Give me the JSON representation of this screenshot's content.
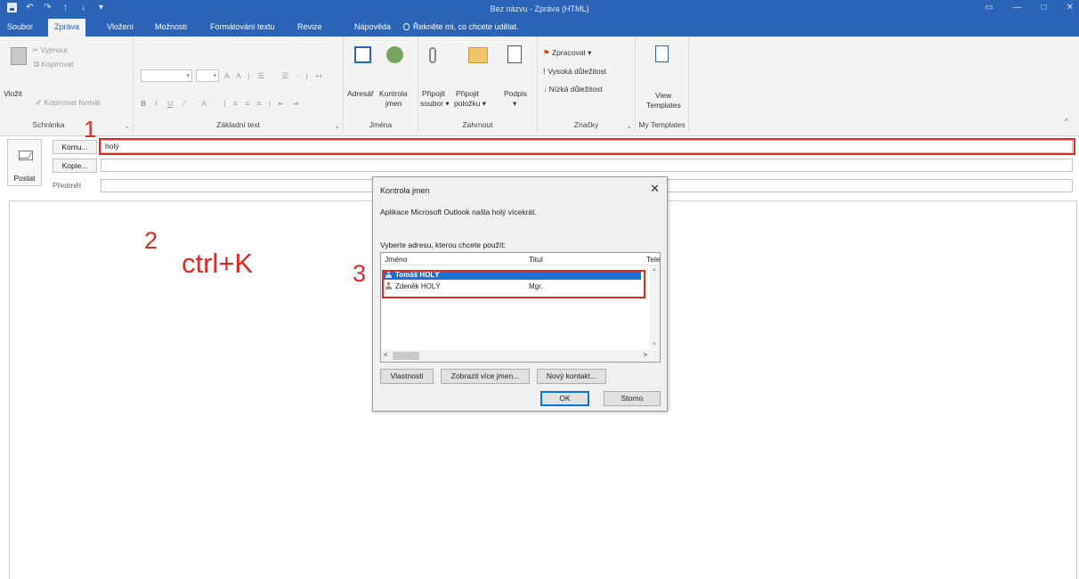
{
  "window": {
    "title": "Bez názvu - Zpráva (HTML)"
  },
  "tabs": [
    "Soubor",
    "Zpráva",
    "Vložení",
    "Možnosti",
    "Formátování textu",
    "Revize",
    "Nápověda"
  ],
  "tell_me": "Řekněte mi, co chcete udělat.",
  "ribbon": {
    "clipboard": {
      "paste": "Vložit",
      "cut": "Vyjmout",
      "copy": "Kopírovat",
      "format_painter": "Kopírovat formát",
      "label": "Schránka"
    },
    "basic_text": {
      "bold": "B",
      "italic": "I",
      "underline": "U",
      "label": "Základní text"
    },
    "names": {
      "address_book": "Adresář",
      "check_names_1": "Kontrola",
      "check_names_2": "jmen",
      "label": "Jména"
    },
    "include": {
      "attach_file_1": "Připojit",
      "attach_file_2": "soubor ▾",
      "attach_item_1": "Připojit",
      "attach_item_2": "položku ▾",
      "signature": "Podpis",
      "signature_arrow": "▾",
      "label": "Zahrnout"
    },
    "tags": {
      "follow_up": "Zpracovat ▾",
      "high_importance": "Vysoká důležitost",
      "low_importance": "Nízká důležitost",
      "label": "Značky"
    },
    "templates": {
      "view_1": "View",
      "view_2": "Templates",
      "label": "My Templates"
    }
  },
  "compose": {
    "send": "Postat",
    "to_button": "Komu...",
    "to_value": "holý",
    "cc_button": "Kopie...",
    "cc_value": "",
    "subject_label": "Předmět",
    "subject_value": ""
  },
  "annotations": {
    "step1": "1",
    "step2": "2",
    "shortcut": "ctrl+K",
    "step3": "3"
  },
  "dialog": {
    "title": "Kontrola jmen",
    "message": "Aplikace Microsoft Outlook našla holý vícekrát.",
    "prompt": "Vyberte adresu, kterou chcete použít:",
    "columns": [
      "Jméno",
      "Titul",
      "Tele"
    ],
    "rows": [
      {
        "name": "Tomáš HOLÝ",
        "title": ""
      },
      {
        "name": "Zdeněk HOLÝ",
        "title": "Mgr."
      }
    ],
    "properties_button": "Vlastnosti",
    "show_more_button": "Zobrazit více jmen...",
    "new_contact_button": "Nový kontakt...",
    "ok_button": "OK",
    "cancel_button": "Storno"
  },
  "colors": {
    "titlebar": "#2b63b7",
    "annotation_red": "#e02a2a",
    "selection_blue": "#1e70d9"
  }
}
